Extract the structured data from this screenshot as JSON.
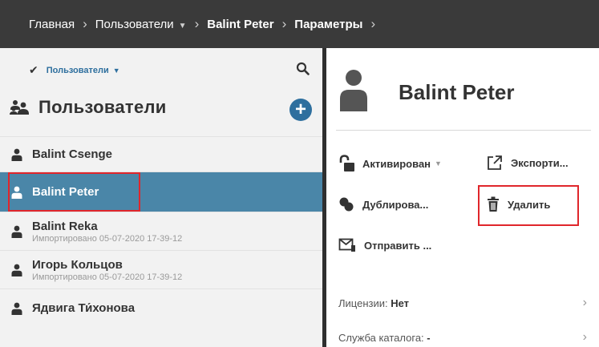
{
  "breadcrumb": {
    "home": "Главная",
    "users": "Пользователи",
    "user": "Balint Peter",
    "page": "Параметры"
  },
  "filter": {
    "label": "Пользователи"
  },
  "section": {
    "title": "Пользователи"
  },
  "users": [
    {
      "name": "Balint Csenge",
      "sub": ""
    },
    {
      "name": "Balint Peter",
      "sub": "",
      "selected": true
    },
    {
      "name": "Balint Reka",
      "sub": "Импортировано 05-07-2020 17-39-12"
    },
    {
      "name": "Игорь Кольцов",
      "sub": "Импортировано 05-07-2020 17-39-12"
    },
    {
      "name": "Ядвига Ти́хонова",
      "sub": ""
    }
  ],
  "detail": {
    "title": "Balint Peter",
    "actions": {
      "activated": "Активирован",
      "export": "Экспорти...",
      "duplicate": "Дублирова...",
      "delete": "Удалить",
      "send": "Отправить ..."
    },
    "info": [
      {
        "label": "Лицензии:",
        "value": "Нет"
      },
      {
        "label": "Служба каталога:",
        "value": "-"
      }
    ]
  },
  "colors": {
    "topbar": "#3a3a3a",
    "selected_row": "#4a86a8",
    "accent": "#2e6f9e",
    "highlight_border": "#e0262b"
  }
}
